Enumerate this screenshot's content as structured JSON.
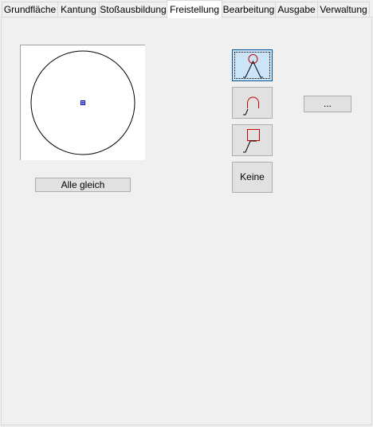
{
  "tabs": [
    {
      "label": "Grundfläche",
      "active": false
    },
    {
      "label": "Kantung",
      "active": false
    },
    {
      "label": "Stoßausbildung",
      "active": false
    },
    {
      "label": "Freistellung",
      "active": true
    },
    {
      "label": "Bearbeitung",
      "active": false
    },
    {
      "label": "Ausgabe",
      "active": false
    },
    {
      "label": "Verwaltung",
      "active": false
    }
  ],
  "preview": {
    "shape": "circle",
    "center_marker_icon": "center-point-icon",
    "outline_color": "#000000",
    "marker_color": "#0000c0"
  },
  "buttons": {
    "all_equal_label": "Alle gleich",
    "none_label": "Keine",
    "more_label": "..."
  },
  "relief_options": [
    {
      "icon": "relief-circle-icon",
      "selected": true
    },
    {
      "icon": "relief-round-icon",
      "selected": false
    },
    {
      "icon": "relief-rectangle-icon",
      "selected": false
    }
  ],
  "colors": {
    "accent": "#cc0000",
    "selected_bg": "#cce4f7",
    "selected_border": "#005499"
  }
}
